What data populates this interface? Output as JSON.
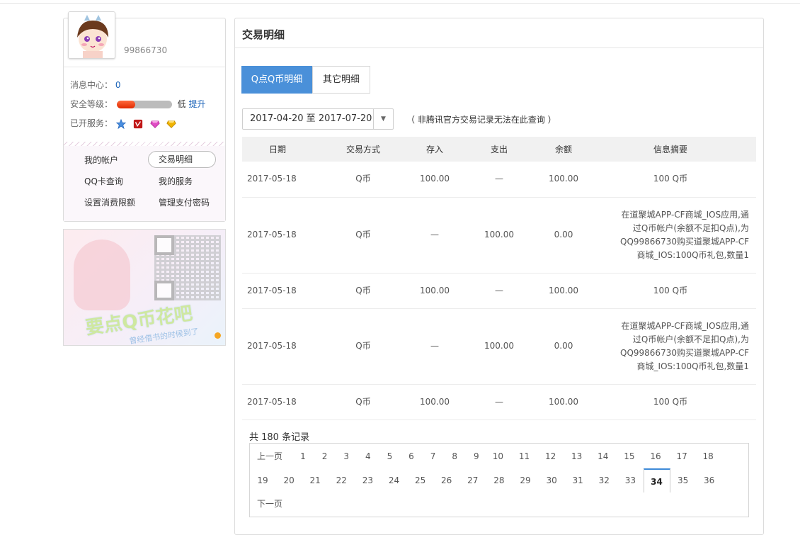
{
  "user": {
    "qq": "99866730"
  },
  "status": {
    "msg_label": "消息中心：",
    "msg_count": "0",
    "security_label": "安全等级：",
    "security_level": 0.33,
    "security_text": "低",
    "security_link": "提升",
    "services_label": "已开服务：",
    "service_icons": [
      "star-icon",
      "vip-badge-icon",
      "pink-diamond-icon",
      "yellow-diamond-icon"
    ]
  },
  "menu": {
    "items": [
      "我的帐户",
      "交易明细",
      "QQ卡查询",
      "我的服务",
      "设置消费限额",
      "管理支付密码"
    ],
    "active": "交易明细"
  },
  "ad": {
    "text": "要点Q币花吧",
    "sub": "曾经借书的时候到了"
  },
  "main": {
    "title": "交易明细",
    "tabs": [
      "Q点Q币明细",
      "其它明细"
    ],
    "date_range": "2017-04-20 至 2017-07-20",
    "note": "（ 非腾讯官方交易记录无法在此查询 ）"
  },
  "table": {
    "headers": [
      "日期",
      "交易方式",
      "存入",
      "支出",
      "余额",
      "信息摘要"
    ],
    "rows": [
      [
        "2017-05-18",
        "Q币",
        "100.00",
        "—",
        "100.00",
        "100 Q币"
      ],
      [
        "2017-05-18",
        "Q币",
        "—",
        "100.00",
        "0.00",
        "在道聚城APP-CF商城_IOS应用,通过Q币帐户(余额不足扣Q点),为QQ99866730购买道聚城APP-CF商城_IOS:100Q币礼包,数量1"
      ],
      [
        "2017-05-18",
        "Q币",
        "100.00",
        "—",
        "100.00",
        "100 Q币"
      ],
      [
        "2017-05-18",
        "Q币",
        "—",
        "100.00",
        "0.00",
        "在道聚城APP-CF商城_IOS应用,通过Q币帐户(余额不足扣Q点),为QQ99866730购买道聚城APP-CF商城_IOS:100Q币礼包,数量1"
      ],
      [
        "2017-05-18",
        "Q币",
        "100.00",
        "—",
        "100.00",
        "100 Q币"
      ]
    ]
  },
  "pagination": {
    "total": "共 180 条记录",
    "prev": "上一页",
    "next": "下一页",
    "current": "34",
    "row1": [
      "1",
      "2",
      "3",
      "4",
      "5",
      "6",
      "7",
      "8",
      "9",
      "10",
      "11",
      "12",
      "13",
      "14",
      "15",
      "16",
      "17",
      "18"
    ],
    "row2": [
      "19",
      "20",
      "21",
      "22",
      "23",
      "24",
      "25",
      "26",
      "27",
      "28",
      "29",
      "30",
      "31",
      "32",
      "33",
      "34",
      "35",
      "36"
    ]
  },
  "colors": {
    "accent": "#4a90d9",
    "link": "#1b63b8",
    "security_bar": "#e02a00"
  }
}
